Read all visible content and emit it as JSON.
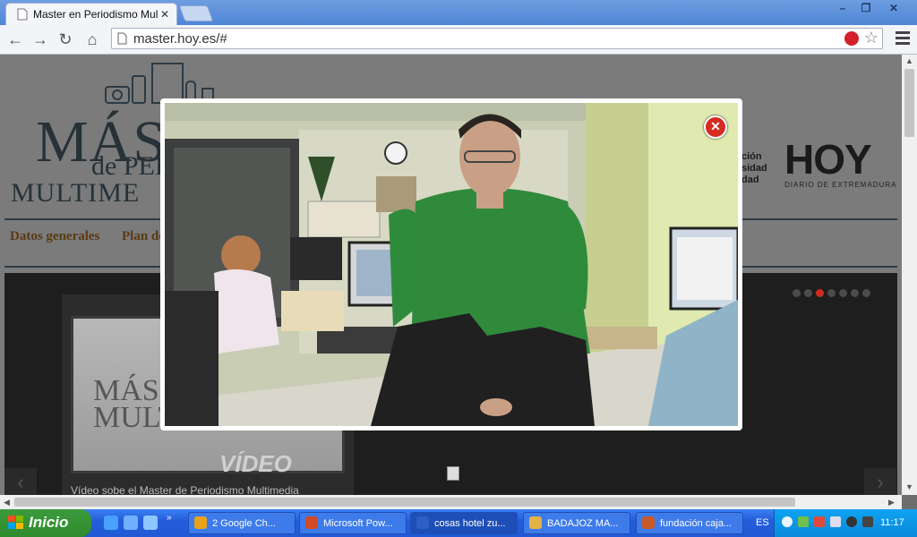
{
  "browser": {
    "tab_title": "Master en Periodismo Multimedia",
    "tab_close": "✕",
    "url": "master.hoy.es/#",
    "window_controls": [
      "–",
      "❐",
      "✕"
    ]
  },
  "site": {
    "logo_line1": "MÁST",
    "logo_line2": "de PERI",
    "logo_line3": "MULTIME",
    "partner_text": [
      "ción",
      "sidad",
      "dad"
    ],
    "brand": "HOY",
    "brand_sub": "DIARIO DE EXTREMADURA",
    "nav": [
      "Datos generales",
      "Plan de"
    ],
    "slider": {
      "video_label": "VÍDEO",
      "caption": "Vídeo sobe el Master de Periodismo Multimedia",
      "thumb_text": "MÁS PER MULTIME",
      "dot_count": 7,
      "active_dot": 2,
      "prev": "‹",
      "next": "›"
    }
  },
  "modal": {
    "close_label": "✕"
  },
  "taskbar": {
    "start_label": "Inicio",
    "tasks": [
      {
        "label": "2 Google Ch...",
        "icon": "chrome-icon",
        "color": "#e8a21b"
      },
      {
        "label": "Microsoft Pow...",
        "icon": "powerpoint-icon",
        "color": "#d04a24"
      },
      {
        "label": "cosas hotel zu...",
        "icon": "word-icon",
        "color": "#2b5fc4"
      },
      {
        "label": "BADAJOZ MA...",
        "icon": "folder-icon",
        "color": "#e3b348"
      },
      {
        "label": "fundación caja...",
        "icon": "app-icon",
        "color": "#c85a2a"
      }
    ],
    "language": "ES",
    "clock": "11:17"
  }
}
